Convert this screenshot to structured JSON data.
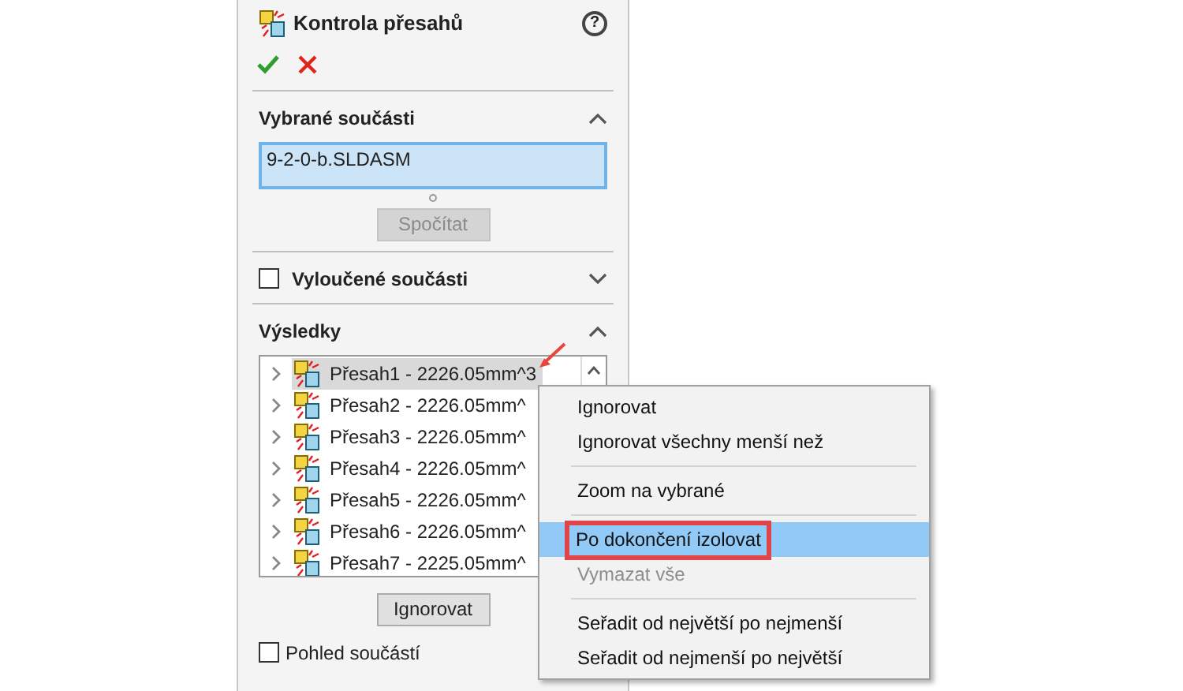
{
  "panel": {
    "title": "Kontrola přesahů",
    "help": "?",
    "sections": [
      {
        "title": "Vybrané součásti",
        "kind": "selection",
        "expanded": true,
        "field_value": "9-2-0-b.SLDASM",
        "button": "Spočítat",
        "button_disabled": true
      },
      {
        "title": "Vyloučené součásti",
        "kind": "checkbox",
        "expanded": false,
        "checked": false
      },
      {
        "title": "Výsledky",
        "kind": "results",
        "expanded": true
      }
    ],
    "results": [
      {
        "label": "Přesah1 - 2226.05mm^3",
        "selected": true
      },
      {
        "label": "Přesah2 - 2226.05mm^",
        "selected": false
      },
      {
        "label": "Přesah3 - 2226.05mm^",
        "selected": false
      },
      {
        "label": "Přesah4 - 2226.05mm^",
        "selected": false
      },
      {
        "label": "Přesah5 - 2226.05mm^",
        "selected": false
      },
      {
        "label": "Přesah6 - 2226.05mm^",
        "selected": false
      },
      {
        "label": "Přesah7 - 2225.05mm^",
        "selected": false
      }
    ],
    "ignore_button": "Ignorovat",
    "component_view": {
      "label": "Pohled součástí",
      "checked": false
    }
  },
  "context_menu": [
    {
      "kind": "item",
      "label": "Ignorovat",
      "disabled": false,
      "selected": false
    },
    {
      "kind": "item",
      "label": "Ignorovat všechny menší než",
      "disabled": false,
      "selected": false
    },
    {
      "kind": "separator"
    },
    {
      "kind": "item",
      "label": "Zoom na vybrané",
      "disabled": false,
      "selected": false
    },
    {
      "kind": "separator"
    },
    {
      "kind": "item",
      "label": "Po dokončení izolovat",
      "disabled": false,
      "selected": true
    },
    {
      "kind": "item",
      "label": "Vymazat vše",
      "disabled": true,
      "selected": false
    },
    {
      "kind": "separator"
    },
    {
      "kind": "item",
      "label": "Seřadit od největší po nejmenší",
      "disabled": false,
      "selected": false
    },
    {
      "kind": "item",
      "label": "Seřadit od nejmenší po největší",
      "disabled": false,
      "selected": false
    }
  ]
}
